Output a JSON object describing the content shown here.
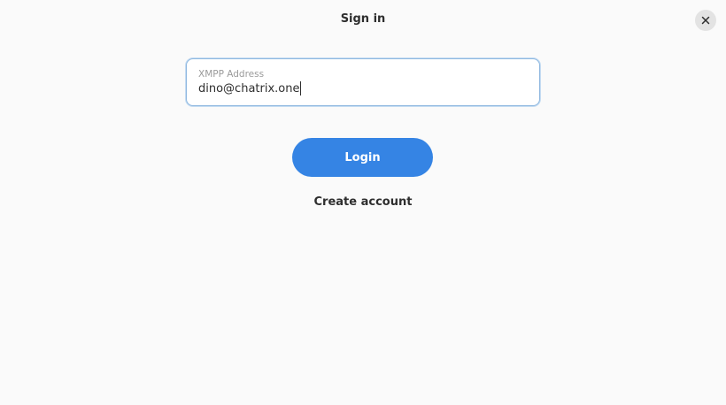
{
  "window": {
    "title": "Sign in"
  },
  "form": {
    "address_label": "XMPP Address",
    "address_value": "dino@chatrix.one",
    "login_label": "Login",
    "create_account_label": "Create account"
  },
  "icons": {
    "close": "close-icon"
  },
  "colors": {
    "accent": "#3584e4",
    "background": "#fafafa",
    "focus_border": "#8fb8e0"
  }
}
